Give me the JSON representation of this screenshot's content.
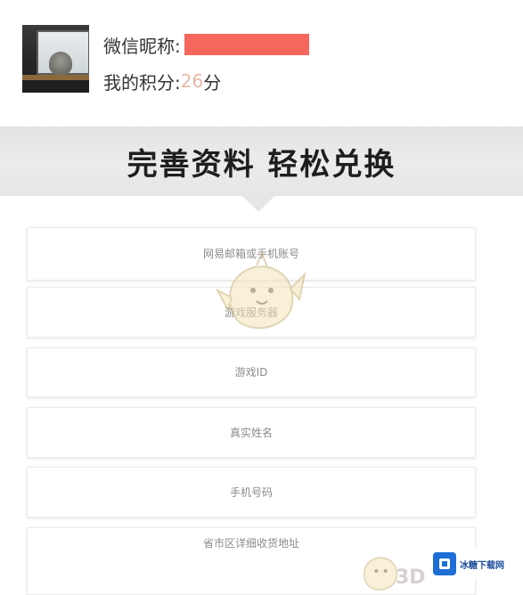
{
  "profile": {
    "nickname_label": "微信昵称:",
    "points_label": "我的积分:",
    "points_value": "26",
    "points_unit": "分"
  },
  "banner": {
    "title": "完善资料 轻松兑换"
  },
  "form": {
    "fields": [
      {
        "placeholder": "网易邮箱或手机账号"
      },
      {
        "placeholder": "游戏服务器"
      },
      {
        "placeholder": "游戏ID"
      },
      {
        "placeholder": "真实姓名"
      },
      {
        "placeholder": "手机号码"
      },
      {
        "placeholder": "省市区详细收货地址"
      }
    ]
  },
  "watermark": {
    "text": "3D",
    "site_name": "冰糖下载网"
  },
  "colors": {
    "redaction": "#f5675c",
    "points_value": "#e9b9a6",
    "banner_bg": "#e6e6e6",
    "brand_blue": "#1d6fd6"
  },
  "icons": {
    "mascot": "mascot-watermark-icon",
    "site_logo": "site-logo-icon"
  }
}
